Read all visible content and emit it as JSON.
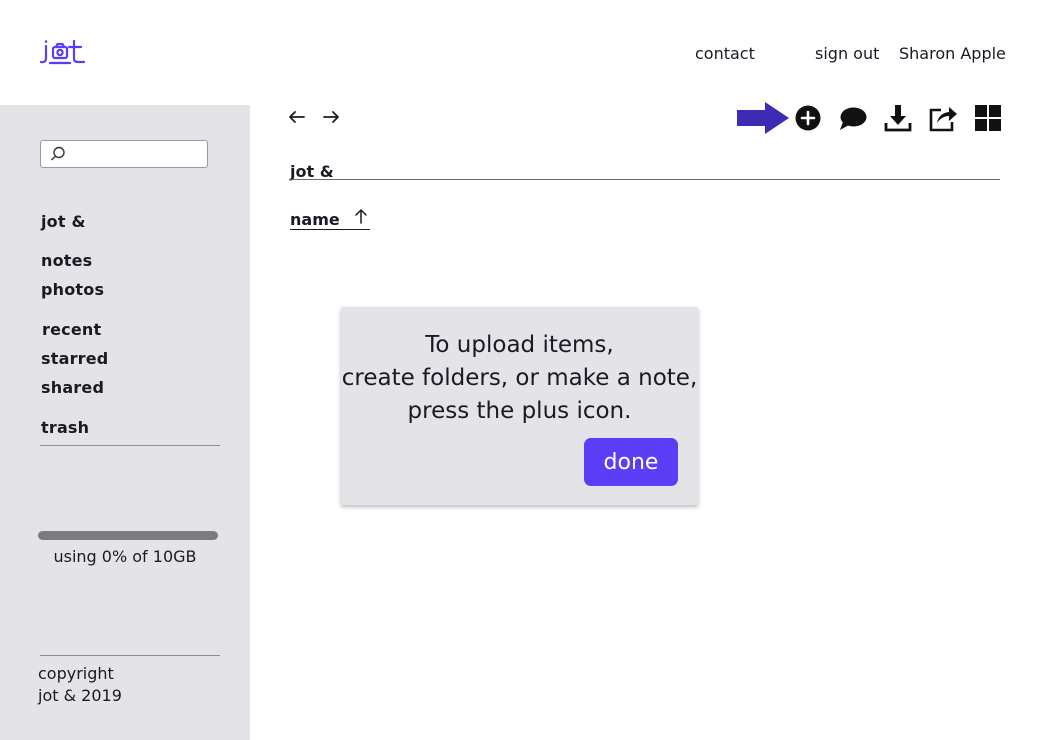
{
  "header": {
    "logo_text": "jot",
    "links": [
      "contact",
      "sign out"
    ],
    "user_name": "Sharon Apple"
  },
  "sidebar": {
    "search_placeholder": "",
    "items": [
      "jot &",
      "notes",
      "photos",
      "recent",
      "starred",
      "shared",
      "trash"
    ],
    "storage": {
      "text": "using 0% of 10GB",
      "used_fraction": 0
    },
    "copyright": [
      "copyright",
      "jot & 2019"
    ]
  },
  "toolbar": {
    "icons": [
      "back-arrow-icon",
      "forward-arrow-icon",
      "plus-icon",
      "comment-icon",
      "download-icon",
      "share-icon",
      "grid-view-icon"
    ],
    "pointer_icon": "pointer-arrow-icon"
  },
  "breadcrumb": "jot &",
  "list": {
    "sort_label": "name",
    "sort_direction": "ascending"
  },
  "tooltip": {
    "lines": [
      "To upload items,",
      "create folders, or make a note,",
      "press the plus icon."
    ],
    "button_label": "done"
  },
  "colors": {
    "accent": "#5b3df5",
    "pointer": "#3c2bb3",
    "sidebar_bg": "#e4e3e8",
    "text": "#1a1a24"
  }
}
